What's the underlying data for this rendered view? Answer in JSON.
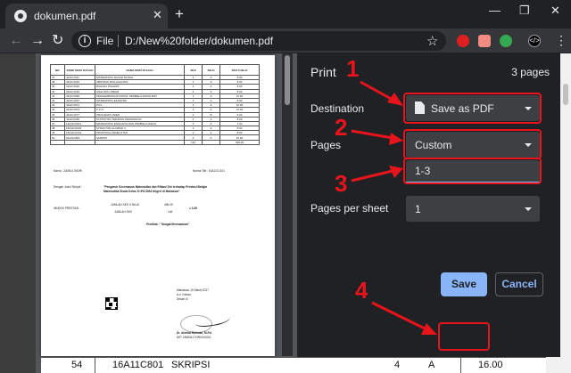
{
  "browser": {
    "tab_title": "dokumen.pdf",
    "tab_close": "✕",
    "new_tab": "+",
    "window_controls": [
      "—",
      "❐",
      "✕"
    ],
    "scheme_label": "File",
    "url": "D:/New%20folder/dokumen.pdf"
  },
  "print_dialog": {
    "title": "Print",
    "page_count": "3 pages",
    "destination_label": "Destination",
    "destination_value": "Save as PDF",
    "pages_label": "Pages",
    "pages_value": "Custom",
    "custom_pages_value": "1-3",
    "pages_per_sheet_label": "Pages per sheet",
    "pages_per_sheet_value": "1",
    "save_label": "Save",
    "cancel_label": "Cancel"
  },
  "annotations": {
    "steps": [
      "1",
      "2",
      "3",
      "4"
    ],
    "accent_color": "#e8141b"
  },
  "preview": {
    "table_headers": [
      "NO.",
      "KODE MATA KULIAH",
      "NAMA MATA KULIAH",
      "SKS",
      "NILAI",
      "SKS X NILAI"
    ],
    "rows": [
      [
        "37",
        "4111C1011",
        "MATEMATIKA DASAR MODAL",
        "2",
        "A",
        "8.00"
      ],
      [
        "38",
        "4111C1021",
        "ABSTRAK DAN ANALISIS",
        "2",
        "A",
        "8.00"
      ],
      [
        "39",
        "4111C1022",
        "BAHASA INGGRIS",
        "2",
        "A",
        "8.00"
      ],
      [
        "40",
        "4111C1033",
        "ANALISIS LINEAR",
        "2",
        "A",
        "8.00"
      ],
      [
        "41",
        "4111C1066",
        "PENGEMBANGAN PROG. PEMBELAJARAN MAT",
        "3",
        "A",
        "12.00"
      ],
      [
        "42",
        "4111C1067",
        "MATEMATIKA EKONOMI",
        "2",
        "A",
        "8.00"
      ],
      [
        "43",
        "4111C1071",
        "P.P.L.",
        "3",
        "A",
        "12.00"
      ],
      [
        "44",
        "4111C1073",
        "K.K.N.",
        "3",
        "A",
        "12.00"
      ],
      [
        "45",
        "4111C1077",
        "PROGRAM LINIER",
        "2",
        "B",
        "6.00"
      ],
      [
        "46",
        "4111C2000",
        "STATISTIKA TERAPAN PENDIDIKAN",
        "2",
        "A",
        "8.00"
      ],
      [
        "47",
        "16A11C0011",
        "MATEMATIKA ENGGANG DAN PEMBELAJARAN",
        "2",
        "A",
        "7.00"
      ],
      [
        "48",
        "16A11C0020",
        "STRUKTUR ALJABAR 3",
        "2",
        "A",
        "8.00"
      ],
      [
        "49",
        "16A11C0101",
        "PROPOSAL PENELITIAN",
        "2",
        "A",
        "8.00"
      ],
      [
        "50",
        "16A11C801",
        "SKRIPSI",
        "4",
        "A",
        "16.00"
      ]
    ],
    "totals": [
      "146",
      "496.00"
    ],
    "student_name_label": "Nama : ZAINUL INDRI",
    "student_number_label": "Nomor Stb : 16A11C1101",
    "thesis_label": "Dengan Judul Skripsi :",
    "thesis_title_1": "\"Pengaruh Kecemasan Matematika dan Efikasi Diri terhadap Prestasi Belajar",
    "thesis_title_2": "Matematika Siswa Kelas XI IPA SMA Negeri di Makassar\"",
    "ipk_label": "INDEKS PRESTASI :",
    "ipk_formula_top": "JUMLAH SKS X NILAI",
    "ipk_formula_bottom": "JUMLAH SKS",
    "ipk_value_top": "496.00",
    "ipk_value_bottom": "146",
    "ipk_result": "= 3.39",
    "predicate": "Predikat : \"Sangat Memuaskan\"",
    "place_date": "Makassar, 19 Maret 2017",
    "signer_role": "A.n. Dekan,",
    "signer_role_2": "Dekan III",
    "signer_name": "Dr. Ahmad Rahman, M.Pd.",
    "signer_nip": "NIP. 196504171990031001"
  },
  "grade_row": {
    "no": "54",
    "code": "16A11C801",
    "name": "SKRIPSI",
    "sks": "4",
    "grade": "A",
    "score": "16.00"
  }
}
